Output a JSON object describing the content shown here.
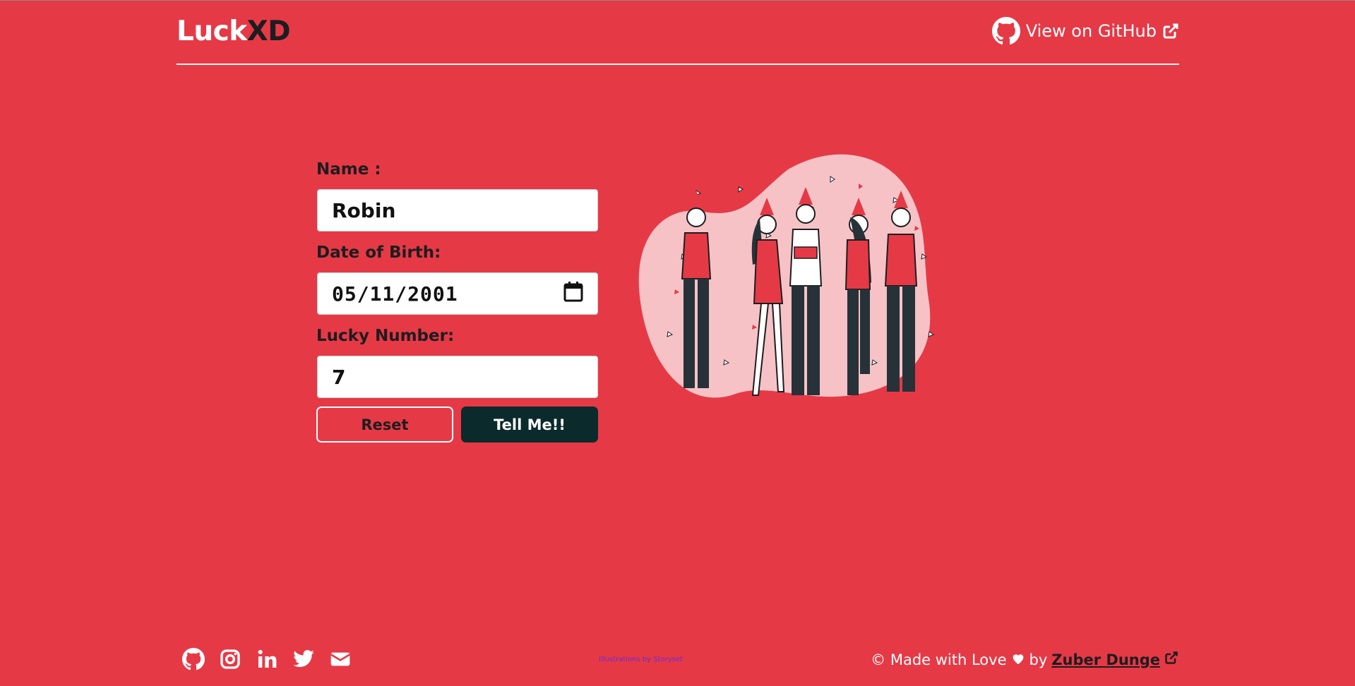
{
  "header": {
    "brand_part1": "Luck",
    "brand_part2": "XD",
    "github_link": "View on GitHub"
  },
  "form": {
    "name_label": "Name :",
    "name_value": "Robin",
    "dob_label": "Date of Birth:",
    "dob_value": "05/11/2001",
    "lucky_label": "Lucky Number:",
    "lucky_value": "7",
    "reset_label": "Reset",
    "submit_label": "Tell Me!!"
  },
  "footer": {
    "icons": [
      "github-icon",
      "instagram-icon",
      "linkedin-icon",
      "twitter-icon",
      "mail-icon"
    ],
    "credit": "Illustrations by Storyset",
    "made_with": "© Made with Love",
    "by": "by",
    "author": "Zuber Dunge"
  },
  "colors": {
    "background": "#e63946",
    "dark": "#0b2a2c",
    "text_dark": "#1d1d1f"
  }
}
